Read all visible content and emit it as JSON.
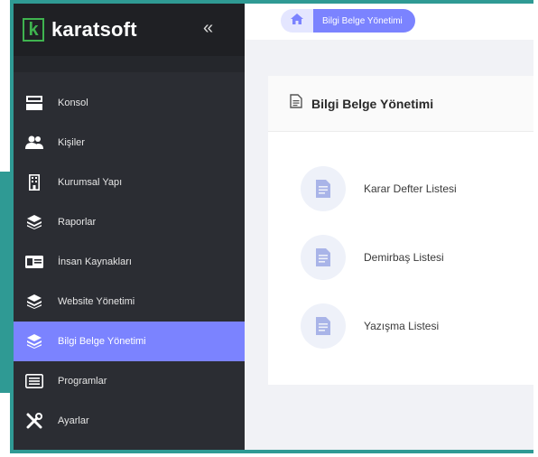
{
  "brand": {
    "logo_letter": "k",
    "name": "karatsoft",
    "collapse_glyph": "«"
  },
  "sidebar": {
    "items": [
      {
        "label": "Konsol",
        "icon": "console-icon",
        "active": false
      },
      {
        "label": "Kişiler",
        "icon": "people-icon",
        "active": false
      },
      {
        "label": "Kurumsal Yapı",
        "icon": "building-icon",
        "active": false
      },
      {
        "label": "Raporlar",
        "icon": "layers-icon",
        "active": false
      },
      {
        "label": "İnsan Kaynakları",
        "icon": "id-card-icon",
        "active": false
      },
      {
        "label": "Website Yönetimi",
        "icon": "layers-icon",
        "active": false
      },
      {
        "label": "Bilgi Belge Yönetimi",
        "icon": "layers-icon",
        "active": true
      },
      {
        "label": "Programlar",
        "icon": "list-icon",
        "active": false
      },
      {
        "label": "Ayarlar",
        "icon": "tools-icon",
        "active": false
      }
    ]
  },
  "breadcrumb": {
    "home_icon": "home-icon",
    "current": "Bilgi Belge Yönetimi"
  },
  "card": {
    "title": "Bilgi Belge Yönetimi",
    "title_icon": "document-icon",
    "items": [
      {
        "label": "Karar Defter Listesi",
        "icon": "document-icon"
      },
      {
        "label": "Demirbaş Listesi",
        "icon": "document-icon"
      },
      {
        "label": "Yazışma Listesi",
        "icon": "document-icon"
      }
    ]
  },
  "colors": {
    "accent": "#7b83ff",
    "frame": "#2f9a94",
    "sidebar": "#2b2d33",
    "logo": "#3fb34f"
  }
}
